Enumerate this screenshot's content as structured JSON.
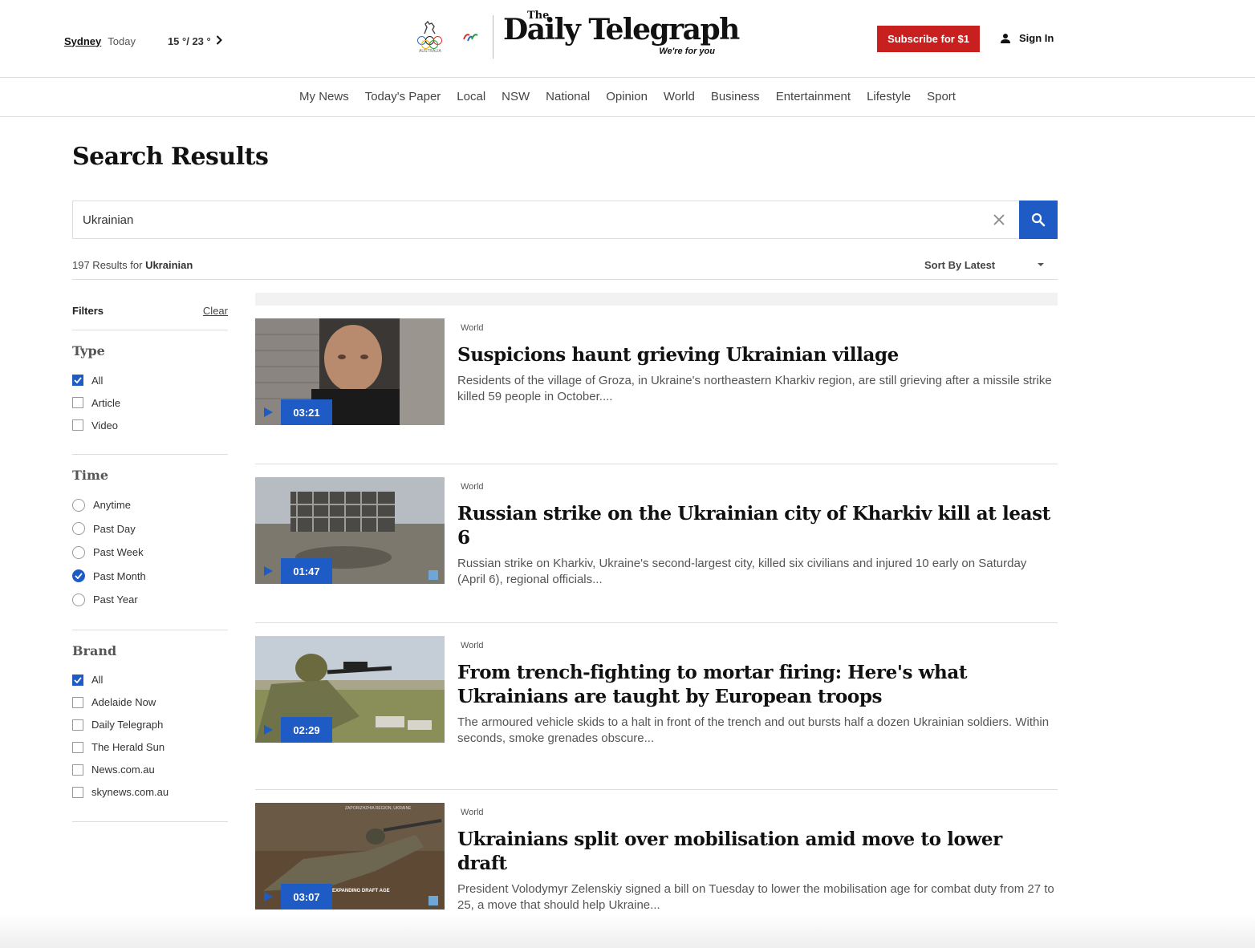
{
  "header": {
    "weather": {
      "city": "Sydney",
      "day": "Today",
      "temp": "15 °/ 23 °"
    },
    "masthead": {
      "the": "The",
      "title": "Daily Telegraph",
      "tagline": "We're for you"
    },
    "olympic_caption": "AUSTRALIA",
    "subscribe_label": "Subscribe for $1",
    "signin_label": "Sign In"
  },
  "nav": {
    "items": [
      "My News",
      "Today's Paper",
      "Local",
      "NSW",
      "National",
      "Opinion",
      "World",
      "Business",
      "Entertainment",
      "Lifestyle",
      "Sport"
    ]
  },
  "page": {
    "title": "Search Results"
  },
  "search": {
    "value": "Ukrainian"
  },
  "results_bar": {
    "count_prefix": "197 Results for",
    "query": "Ukrainian",
    "sort_label": "Sort By Latest"
  },
  "filters": {
    "title": "Filters",
    "clear_label": "Clear",
    "type": {
      "title": "Type",
      "options": [
        "All",
        "Article",
        "Video"
      ],
      "selected": [
        0
      ]
    },
    "time": {
      "title": "Time",
      "options": [
        "Anytime",
        "Past Day",
        "Past Week",
        "Past Month",
        "Past Year"
      ],
      "selected": 3
    },
    "brand": {
      "title": "Brand",
      "options": [
        "All",
        "Adelaide Now",
        "Daily Telegraph",
        "The Herald Sun",
        "News.com.au",
        "skynews.com.au"
      ],
      "selected": [
        0
      ]
    }
  },
  "results": [
    {
      "category": "World",
      "headline": "Suspicions haunt grieving Ukrainian village",
      "summary": "Residents of the village of Groza, in Ukraine's northeastern Kharkiv region, are still grieving after a missile strike killed 59 people in October....",
      "duration": "03:21"
    },
    {
      "category": "World",
      "headline": "Russian strike on the Ukrainian city of Kharkiv kill at least 6",
      "summary": "Russian strike on Kharkiv, Ukraine's second-largest city, killed six civilians and injured 10 early on Saturday (April 6), regional officials...",
      "duration": "01:47"
    },
    {
      "category": "World",
      "headline": "From trench-fighting to mortar firing: Here's what Ukrainians are taught by European troops",
      "summary": "The armoured vehicle skids to a halt in front of the trench and out bursts half a dozen Ukrainian soldiers. Within seconds, smoke grenades obscure...",
      "duration": "02:29"
    },
    {
      "category": "World",
      "headline": "Ukrainians split over mobilisation amid move to lower draft",
      "summary": "President Volodymyr Zelenskiy signed a bill on Tuesday to lower the mobilisation age for combat duty from 27 to 25, a move that should help Ukraine...",
      "duration": "03:07",
      "thumb_caption": "EXPANDING DRAFT AGE"
    }
  ],
  "colors": {
    "accent_blue": "#1f5bc4",
    "subscribe_red": "#c8201f"
  }
}
